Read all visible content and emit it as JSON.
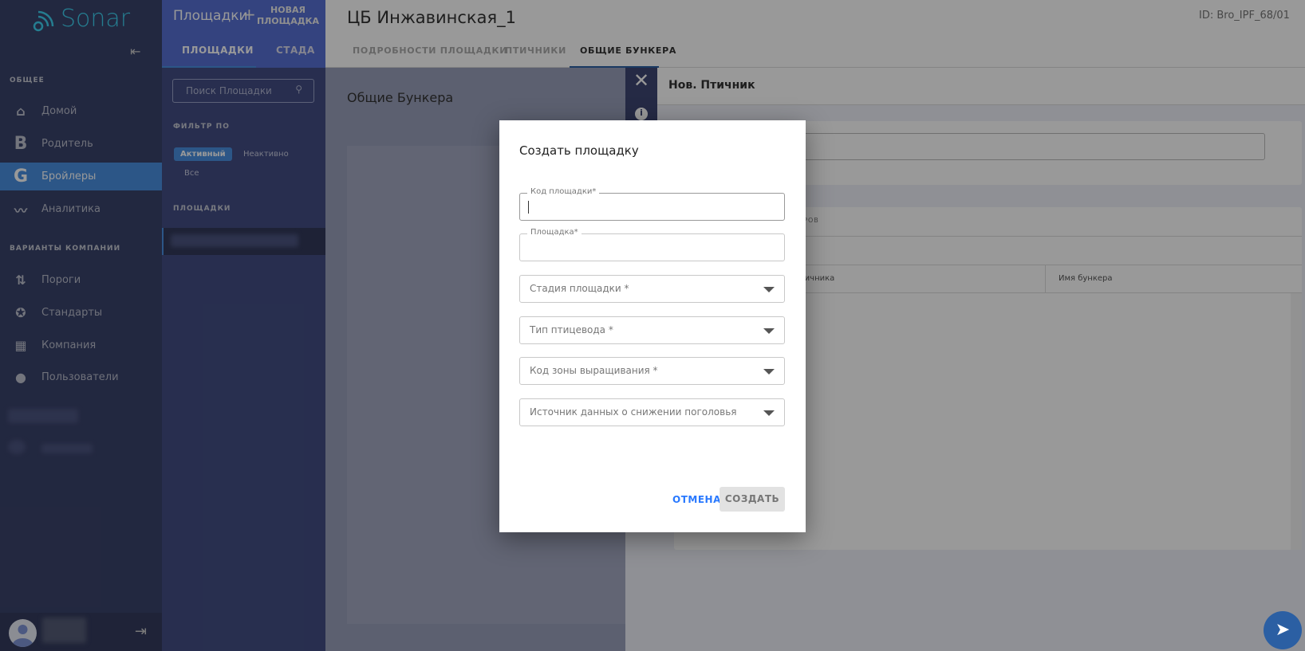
{
  "sidebar": {
    "logo": "Sonar",
    "section_general": "ОБЩЕЕ",
    "items": [
      {
        "label": "Домой",
        "icon": "home-icon"
      },
      {
        "label": "Родитель",
        "icon": "B"
      },
      {
        "label": "Бройлеры",
        "icon": "G"
      },
      {
        "label": "Аналитика",
        "icon": "analytics-icon"
      }
    ],
    "section_company": "ВАРИАНТЫ КОМПАНИИ",
    "company_items": [
      {
        "label": "Пороги",
        "icon": "thresholds-icon"
      },
      {
        "label": "Стандарты",
        "icon": "award-icon"
      },
      {
        "label": "Компания",
        "icon": "building-icon"
      },
      {
        "label": "Пользователи",
        "icon": "user-icon"
      }
    ]
  },
  "sites_panel": {
    "title": "Площадки",
    "new_site": "НОВАЯ ПЛОЩАДКА",
    "tabs": [
      "ПЛОЩАДКИ",
      "СТАДА"
    ],
    "search_placeholder": "Поиск Площадки",
    "filter_label": "ФИЛЬТР ПО",
    "filters": [
      "Активный",
      "Неактивно",
      "Все"
    ],
    "list_label": "ПЛОЩАДКИ"
  },
  "main": {
    "title": "ЦБ Инжавинская_1",
    "id": "ID: Bro_IPF_68/01",
    "tabs": [
      "ПОДРОБНОСТИ ПЛОЩАДКИ",
      "ПТИЧНИКИ",
      "ОБЩИЕ БУНКЕРА"
    ],
    "section_title": "Общие Бункера"
  },
  "drawer": {
    "title": "Нов. Птичник",
    "table_title": "БУНКЕРОВ",
    "columns": [
      "Код птичника",
      "Имя бункера"
    ]
  },
  "dialog": {
    "title": "Создать площадку",
    "fields": [
      {
        "label": "Код площадки*",
        "value": ""
      },
      {
        "label": "Площадка*",
        "value": ""
      }
    ],
    "selects": [
      "Стадия площадки *",
      "Тип птицевода *",
      "Код зоны выращивания *",
      "Источник данных о снижении поголовья"
    ],
    "cancel": "ОТМЕНА",
    "create": "СОЗДАТЬ"
  },
  "colors": {
    "accent": "#4a90e2",
    "cancel": "#2979ff",
    "fab": "#2b5fa3"
  }
}
